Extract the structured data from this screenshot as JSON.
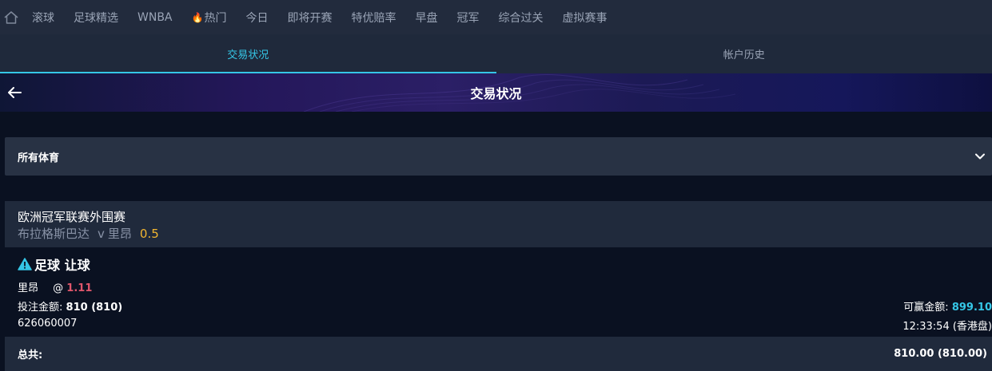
{
  "nav": {
    "items": [
      {
        "label": "滚球"
      },
      {
        "label": "足球精选"
      },
      {
        "label": "WNBA"
      },
      {
        "label": "热门",
        "icon": "fire-icon"
      },
      {
        "label": "今日"
      },
      {
        "label": "即将开赛"
      },
      {
        "label": "特优赔率"
      },
      {
        "label": "早盘"
      },
      {
        "label": "冠军"
      },
      {
        "label": "综合过关"
      },
      {
        "label": "虚拟赛事"
      }
    ]
  },
  "tabs": [
    {
      "label": "交易状况",
      "active": true
    },
    {
      "label": "帐户历史",
      "active": false
    }
  ],
  "banner": {
    "title": "交易状况"
  },
  "filter": {
    "label": "所有体育"
  },
  "bet": {
    "league": "欧洲冠军联赛外围赛",
    "home_team": "布拉格斯巴达",
    "vs": "v",
    "away_team": "里昂",
    "handicap": "0.5",
    "bet_type": "足球 让球",
    "selection": "里昂",
    "at": "@",
    "odds": "1.11",
    "stake_label": "投注金额:",
    "stake_value": "810 (810)",
    "win_label": "可赢金额:",
    "win_value": "899.10",
    "ticket_id": "626060007",
    "time": "12:33:54 (香港盘)"
  },
  "total": {
    "label": "总共:",
    "value": "810.00 (810.00)"
  },
  "colors": {
    "accent": "#35c6e6",
    "odds": "#e0566b",
    "handicap": "#f2b630",
    "fire": "#ff8a1e"
  }
}
